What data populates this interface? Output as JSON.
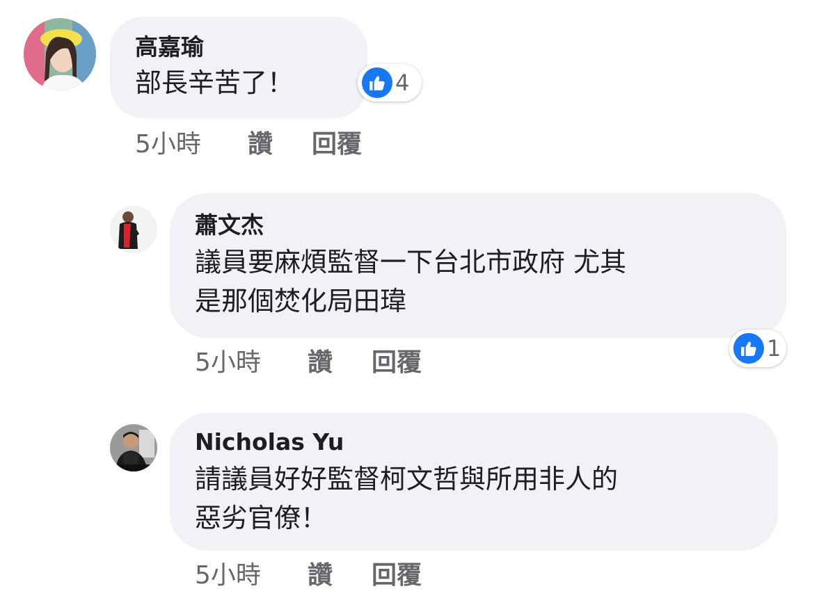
{
  "comments": [
    {
      "author": "高嘉瑜",
      "lines": [
        "部長辛苦了！"
      ],
      "reaction_count": "4",
      "time": "5小時",
      "like_label": "讚",
      "reply_label": "回覆"
    },
    {
      "author": "蕭文杰",
      "lines": [
        "議員要麻煩監督一下台北市政府 尤其",
        "是那個焚化局田瑋"
      ],
      "reaction_count": "1",
      "time": "5小時",
      "like_label": "讚",
      "reply_label": "回覆"
    },
    {
      "author": "Nicholas Yu",
      "lines": [
        "請議員好好監督柯文哲與所用非人的",
        "惡劣官僚！"
      ],
      "time": "5小時",
      "like_label": "讚",
      "reply_label": "回覆"
    }
  ],
  "colors": {
    "bubble": "#f0f2f5",
    "like_blue": "#1877f2",
    "secondary_text": "#65676b"
  },
  "icons": [
    "avatar",
    "like-thumb-icon"
  ]
}
